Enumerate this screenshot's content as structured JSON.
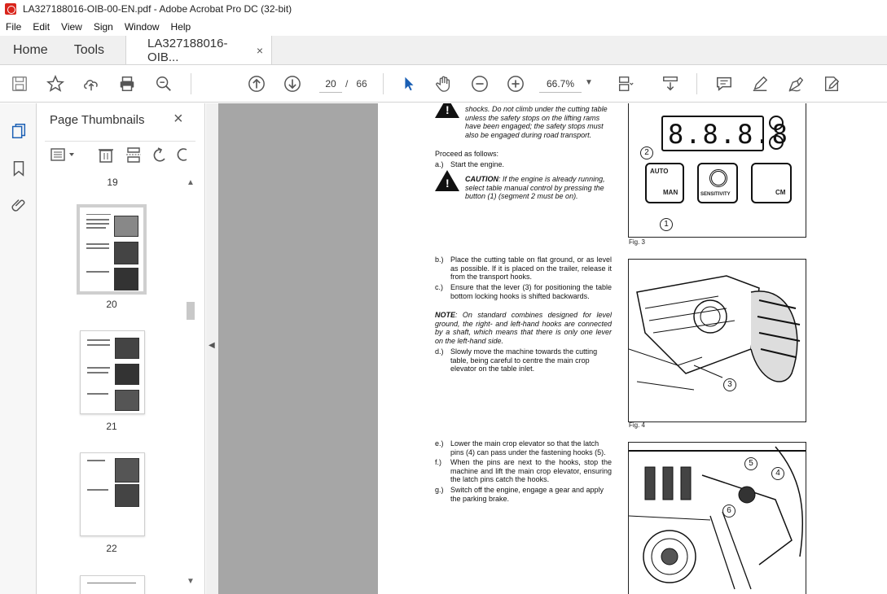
{
  "window": {
    "title": "LA327188016-OIB-00-EN.pdf - Adobe Acrobat Pro DC (32-bit)"
  },
  "menu": [
    "File",
    "Edit",
    "View",
    "Sign",
    "Window",
    "Help"
  ],
  "tabs": {
    "home": "Home",
    "tools": "Tools",
    "document": "LA327188016-OIB...",
    "close": "×"
  },
  "toolbar": {
    "page_current": "20",
    "page_separator": "/",
    "page_total": "66",
    "zoom": "66.7%",
    "zoom_caret": "▼"
  },
  "thumbnails": {
    "title": "Page Thumbnails",
    "close": "×",
    "pages": [
      {
        "label": "19"
      },
      {
        "label": "20"
      },
      {
        "label": "21"
      },
      {
        "label": "22"
      }
    ]
  },
  "document": {
    "top_warning": "shocks. Do not climb under the cutting table unless the safety stops on the lifting rams have been engaged; the safety stops must also be engaged during road transport.",
    "proceed": "Proceed as follows:",
    "step_a": {
      "label": "a.)",
      "text": "Start the engine."
    },
    "caution": {
      "label": "CAUTION",
      "text": ": If the engine is already running, select table manual control by pressing the button (1) (segment 2 must be on)."
    },
    "step_b": {
      "label": "b.)",
      "text": "Place the cutting table on flat ground, or as level as possible. If it is placed on the trailer, release it from the transport hooks."
    },
    "step_c": {
      "label": "c.)",
      "text": "Ensure that the lever (3) for positioning the table bottom locking hooks is shifted backwards."
    },
    "note": {
      "label": "NOTE",
      "text": ": On standard combines designed for level ground, the right- and left-hand hooks are connected by a shaft, which means that there is only one lever on the left-hand side."
    },
    "step_d": {
      "label": "d.)",
      "text": "Slowly move the machine towards the cutting table, being careful to centre the main crop elevator on the table inlet."
    },
    "step_e": {
      "label": "e.)",
      "text": "Lower the main crop elevator so that the latch pins (4) can pass under the fastening hooks (5)."
    },
    "step_f": {
      "label": "f.)",
      "text": "When the pins are next to the hooks, stop the machine and lift the main crop elevator, ensuring the latch pins catch the hooks."
    },
    "step_g": {
      "label": "g.)",
      "text": "Switch off the engine, engage a gear and apply the parking brake."
    },
    "fig3": {
      "caption": "Fig. 3",
      "display": "8.8.8.8",
      "auto": "AUTO",
      "man": "MAN",
      "sensitivity": "SENSITIVITY",
      "cm": "CM",
      "callout1": "1",
      "callout2": "2"
    },
    "fig4": {
      "caption": "Fig. 4",
      "callout3": "3"
    },
    "fig5": {
      "callout4": "4",
      "callout5": "5",
      "callout6": "6"
    }
  }
}
